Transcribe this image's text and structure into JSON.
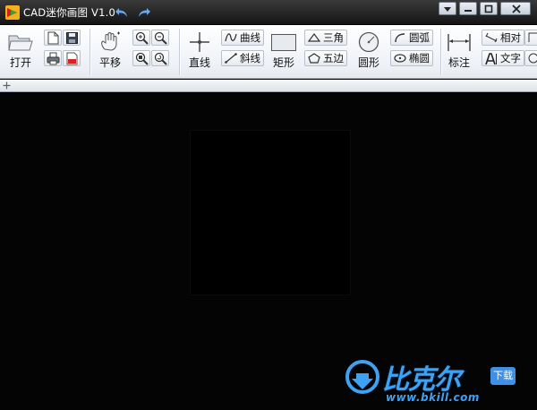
{
  "app": {
    "title": "CAD迷你画图 V1.0"
  },
  "ribbon": {
    "open_label": "打开",
    "pan_label": "平移",
    "line_label": "直线",
    "curve_label": "曲线",
    "slant_label": "斜线",
    "rect_label": "矩形",
    "triangle_label": "三角",
    "pentagon_label": "五边",
    "circle_label": "圆形",
    "arc_label": "圆弧",
    "ellipse_label": "椭圆",
    "dimension_label": "标注",
    "relative_label": "相对",
    "text_label": "文字"
  },
  "watermark": {
    "main": "比克尔",
    "url": "www.bkill.com",
    "badge": "下载"
  },
  "colors": {
    "canvas": "#040405",
    "titlebar": "#1f1f1f",
    "ribbon": "#f3f5f9",
    "watermark": "#3ea2f4"
  }
}
